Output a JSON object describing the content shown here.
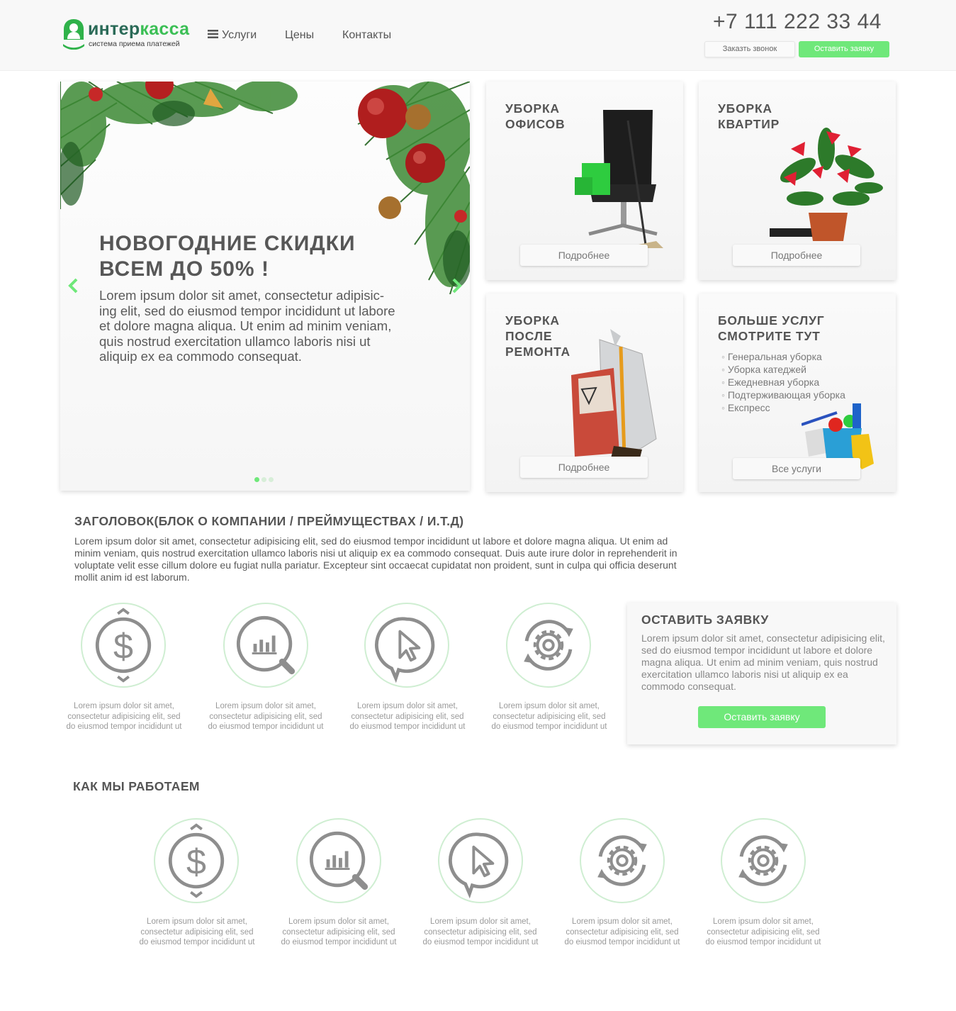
{
  "colors": {
    "accent": "#6fe87a",
    "logo_dark": "#2a6a57",
    "logo_green": "#3bbf55",
    "text": "#5b5b5b"
  },
  "header": {
    "logo_name_part1": "интер",
    "logo_name_part2": "касса",
    "logo_tagline": "система приема платежей",
    "nav": {
      "services": "Услуги",
      "prices": "Цены",
      "contacts": "Контакты"
    },
    "phone": "+7 111 222 33 44",
    "call_button": "Заказть звонок",
    "order_button": "Оставить заявку"
  },
  "slider": {
    "title_line1": "НОВОГОДНИЕ СКИДКИ",
    "title_line2": "ВСЕМ ДО 50% !",
    "text": "Lorem ipsum dolor sit amet, consectetur adipisic-ing elit, sed do eiusmod tempor incididunt ut labore et dolore magna aliqua. Ut enim ad minim veniam, quis nostrud exercitation ullamco laboris nisi ut aliquip ex ea commodo consequat.",
    "dots_count": 3,
    "active_dot": 1
  },
  "cards": [
    {
      "title_l1": "УБОРКА",
      "title_l2": "ОФИСОВ",
      "title_l3": "",
      "button": "Подробнее"
    },
    {
      "title_l1": "УБОРКА",
      "title_l2": "КВАРТИР",
      "title_l3": "",
      "button": "Подробнее"
    },
    {
      "title_l1": "УБОРКА",
      "title_l2": "ПОСЛЕ",
      "title_l3": "РЕМОНТА",
      "button": "Подробнее"
    },
    {
      "title_l1": "БОЛЬШЕ УСЛУГ",
      "title_l2": "СМОТРИТЕ ТУТ",
      "title_l3": "",
      "button": "Все услуги",
      "list": [
        "Генеральная уборка",
        "Уборка катеджей",
        "Ежедневная уборка",
        "Подтерживающая уборка",
        "Експресс"
      ]
    }
  ],
  "about": {
    "title": "ЗАГОЛОВОК(БЛОК О КОМПАНИИ / ПРЕЙМУЩЕСТВАХ / И.Т.Д)",
    "text": "Lorem ipsum dolor sit amet, consectetur adipisicing elit, sed do eiusmod tempor incididunt ut labore et dolore magna aliqua. Ut enim ad minim veniam, quis nostrud exercitation ullamco laboris nisi ut aliquip ex ea commodo consequat. Duis aute irure dolor in reprehenderit in voluptate velit esse cillum dolore eu fugiat nulla pariatur. Excepteur sint occaecat cupidatat non proident, sunt in culpa qui officia deserunt mollit anim id est laborum."
  },
  "features": [
    {
      "icon": "dollar-icon",
      "text": "Lorem ipsum dolor sit amet, consectetur adipisicing elit, sed do eiusmod tempor incididunt ut"
    },
    {
      "icon": "chart-search-icon",
      "text": "Lorem ipsum dolor sit amet, consectetur adipisicing elit, sed do eiusmod tempor incididunt ut"
    },
    {
      "icon": "cursor-bubble-icon",
      "text": "Lorem ipsum dolor sit amet, consectetur adipisicing elit, sed do eiusmod tempor incididunt ut"
    },
    {
      "icon": "gear-refresh-icon",
      "text": "Lorem ipsum dolor sit amet, consectetur adipisicing elit, sed do eiusmod tempor incididunt ut"
    }
  ],
  "order_box": {
    "title": "ОСТАВИТЬ ЗАЯВКУ",
    "text": "Lorem ipsum dolor sit amet, consectetur adipisicing elit, sed do eiusmod tempor incididunt ut labore et dolore magna aliqua. Ut enim ad minim veniam, quis nostrud exercitation ullamco laboris nisi ut aliquip ex ea commodo consequat.",
    "button": "Оставить заявку"
  },
  "how": {
    "title": "КАК МЫ РАБОТАЕМ",
    "steps": [
      {
        "icon": "dollar-icon",
        "text": "Lorem ipsum dolor sit amet, consectetur adipisicing elit, sed do eiusmod tempor incididunt ut"
      },
      {
        "icon": "chart-search-icon",
        "text": "Lorem ipsum dolor sit amet, consectetur adipisicing elit, sed do eiusmod tempor incididunt ut"
      },
      {
        "icon": "cursor-bubble-icon",
        "text": "Lorem ipsum dolor sit amet, consectetur adipisicing elit, sed do eiusmod tempor incididunt ut"
      },
      {
        "icon": "gear-refresh-icon",
        "text": "Lorem ipsum dolor sit amet, consectetur adipisicing elit, sed do eiusmod tempor incididunt ut"
      },
      {
        "icon": "gear-refresh-icon",
        "text": "Lorem ipsum dolor sit amet, consectetur adipisicing elit, sed do eiusmod tempor incididunt ut"
      }
    ]
  }
}
